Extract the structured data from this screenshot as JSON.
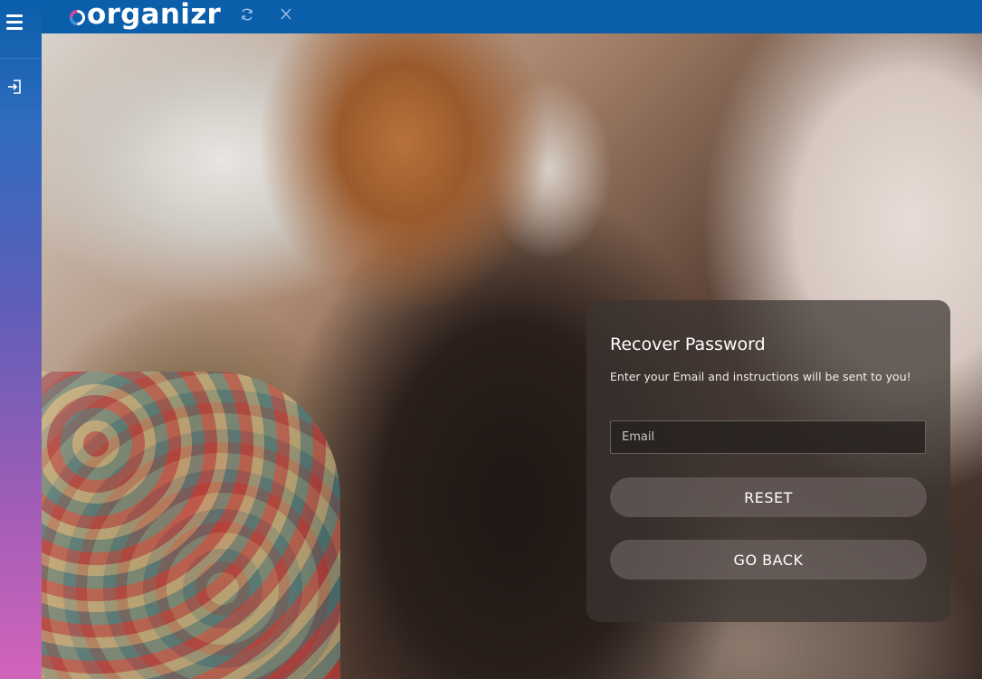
{
  "app": {
    "logo_text": "organizr"
  },
  "sidebar": {
    "menu_icon": "hamburger-menu-icon",
    "login_icon": "sign-in-icon"
  },
  "topbar": {
    "refresh_icon": "refresh-icon",
    "close_icon": "close-icon"
  },
  "recover": {
    "title": "Recover Password",
    "subtitle": "Enter your Email and instructions will be sent to you!",
    "email_placeholder": "Email",
    "email_value": "",
    "reset_label": "RESET",
    "back_label": "GO BACK"
  },
  "colors": {
    "topbar": "#0a5eaa",
    "sidebar_top": "#0a5eaa",
    "sidebar_bottom": "#d164b9",
    "logo_accent": "#e0409e"
  }
}
